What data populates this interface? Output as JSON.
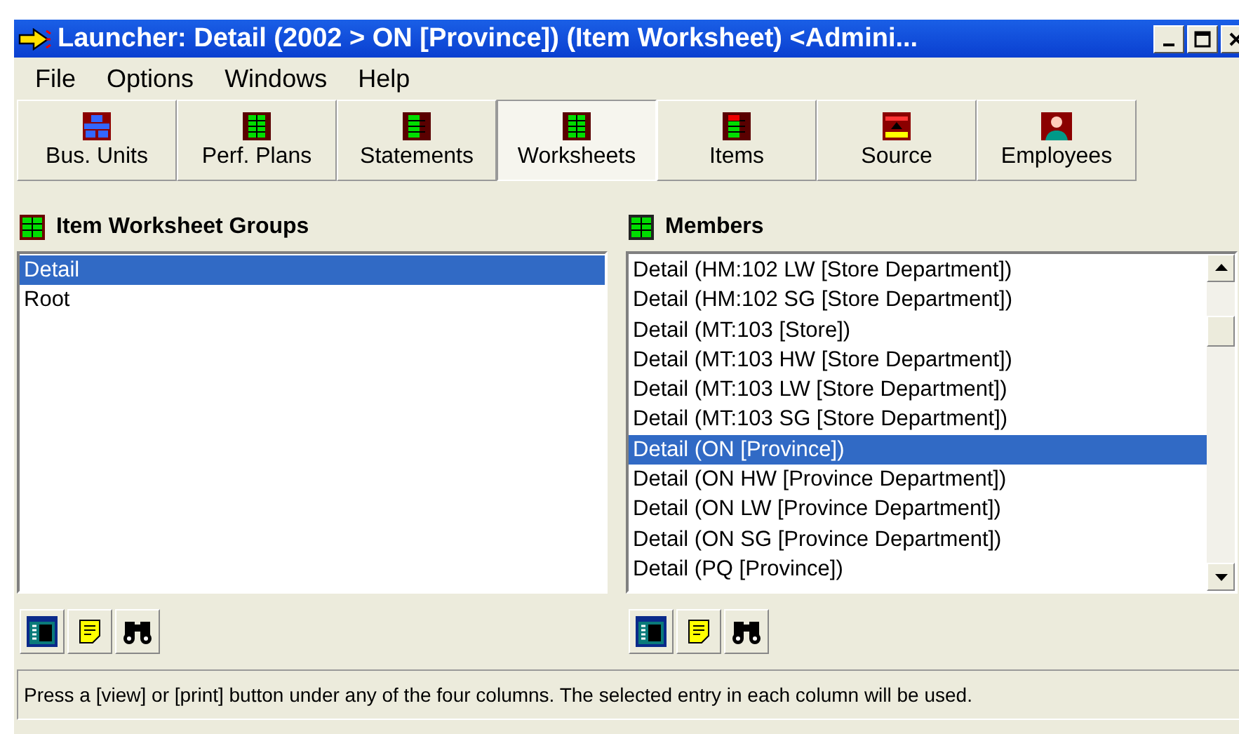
{
  "window": {
    "title": "Launcher: Detail (2002 > ON [Province])  (Item Worksheet)   <Admini..."
  },
  "menu": [
    "File",
    "Options",
    "Windows",
    "Help"
  ],
  "tabs": [
    {
      "label": "Bus. Units",
      "selected": false
    },
    {
      "label": "Perf. Plans",
      "selected": false
    },
    {
      "label": "Statements",
      "selected": false
    },
    {
      "label": "Worksheets",
      "selected": true
    },
    {
      "label": "Items",
      "selected": false
    },
    {
      "label": "Source",
      "selected": false
    },
    {
      "label": "Employees",
      "selected": false
    }
  ],
  "groups": {
    "heading": "Item Worksheet Groups",
    "items": [
      {
        "label": "Detail",
        "selected": true
      },
      {
        "label": "Root",
        "selected": false
      }
    ]
  },
  "members": {
    "heading": "Members",
    "items": [
      {
        "label": "Detail (HM:102 LW [Store Department])",
        "selected": false
      },
      {
        "label": "Detail (HM:102 SG [Store Department])",
        "selected": false
      },
      {
        "label": "Detail (MT:103 [Store])",
        "selected": false
      },
      {
        "label": "Detail (MT:103 HW [Store Department])",
        "selected": false
      },
      {
        "label": "Detail (MT:103 LW [Store Department])",
        "selected": false
      },
      {
        "label": "Detail (MT:103 SG [Store Department])",
        "selected": false
      },
      {
        "label": "Detail (ON [Province])",
        "selected": true
      },
      {
        "label": "Detail (ON HW [Province Department])",
        "selected": false
      },
      {
        "label": "Detail (ON LW [Province Department])",
        "selected": false
      },
      {
        "label": "Detail (ON SG [Province Department])",
        "selected": false
      },
      {
        "label": "Detail (PQ [Province])",
        "selected": false
      }
    ]
  },
  "status_bar": "Press a [view] or [print] button under any of the four columns.  The selected entry in each column will be used."
}
